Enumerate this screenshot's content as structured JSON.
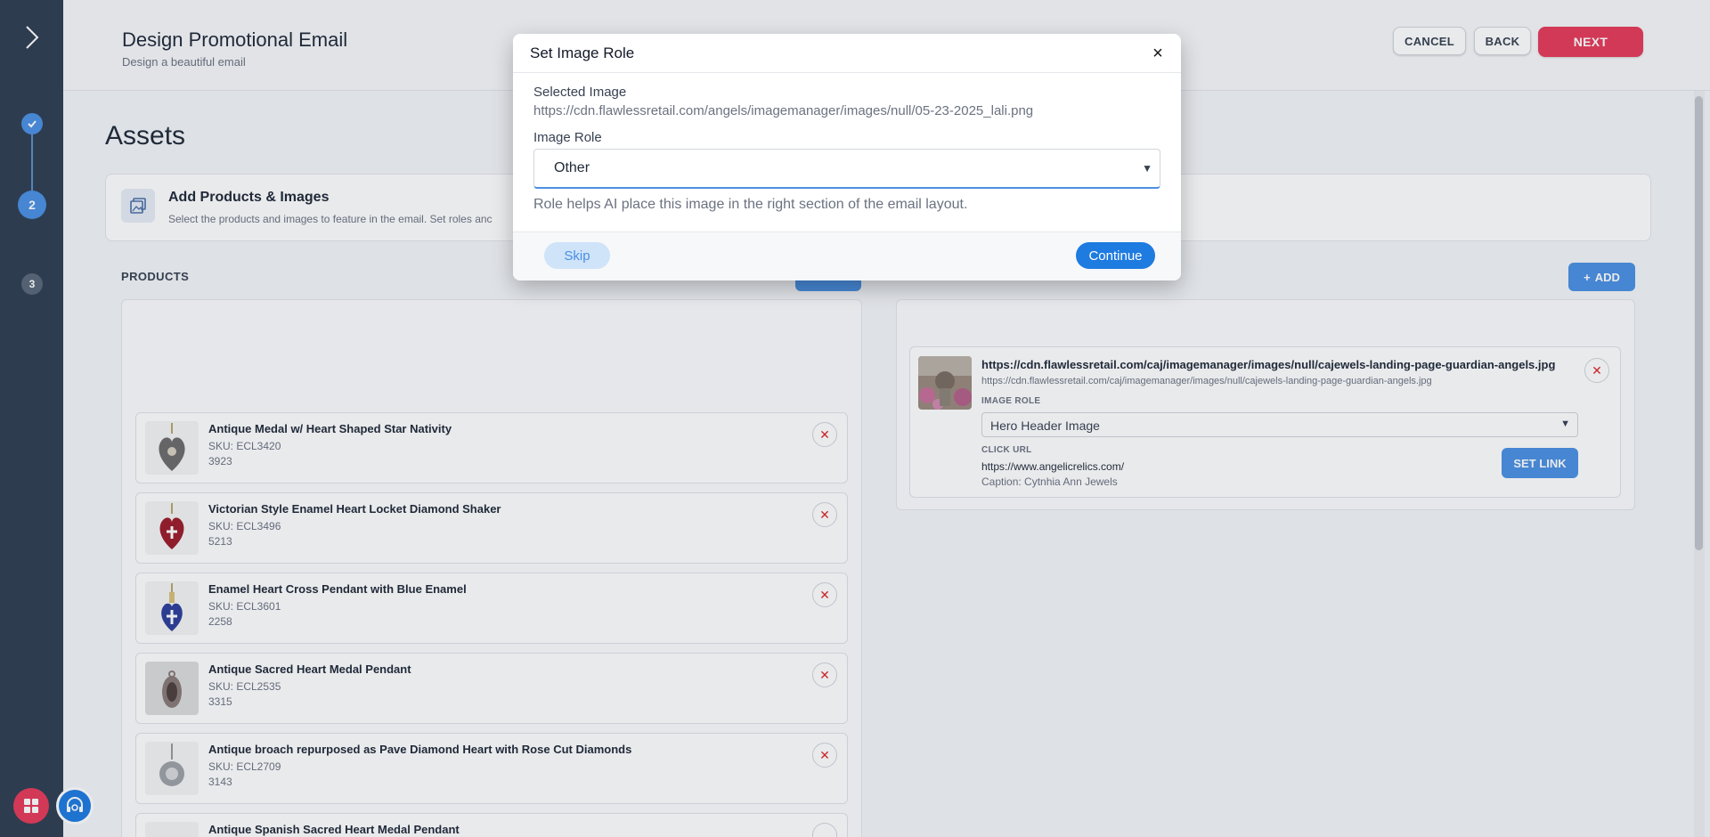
{
  "header": {
    "title": "Design Promotional Email",
    "subtitle": "Design a beautiful email",
    "cancel_label": "CANCEL",
    "back_label": "BACK",
    "next_label": "NEXT"
  },
  "steps": [
    "",
    "2",
    "3"
  ],
  "assets": {
    "title": "Assets",
    "card_title": "Add Products & Images",
    "card_desc": "Select the products and images to feature in the email. Set roles anc"
  },
  "products": {
    "label": "PRODUCTS",
    "items": [
      {
        "name": "Antique Medal w/ Heart Shaped Star Nativity",
        "sku": "SKU: ECL3420",
        "num": "3923"
      },
      {
        "name": "Victorian Style Enamel Heart Locket Diamond Shaker",
        "sku": "SKU: ECL3496",
        "num": "5213"
      },
      {
        "name": "Enamel Heart Cross Pendant with Blue Enamel",
        "sku": "SKU: ECL3601",
        "num": "2258"
      },
      {
        "name": "Antique Sacred Heart Medal Pendant",
        "sku": "SKU: ECL2535",
        "num": "3315"
      },
      {
        "name": "Antique broach repurposed as Pave Diamond Heart with Rose Cut Diamonds",
        "sku": "SKU: ECL2709",
        "num": "3143"
      },
      {
        "name": "Antique Spanish Sacred Heart Medal Pendant",
        "sku": "",
        "num": ""
      }
    ]
  },
  "images": {
    "add_label": "ADD",
    "card": {
      "title": "https://cdn.flawlessretail.com/caj/imagemanager/images/null/cajewels-landing-page-guardian-angels.jpg",
      "url": "https://cdn.flawlessretail.com/caj/imagemanager/images/null/cajewels-landing-page-guardian-angels.jpg",
      "role_label": "IMAGE ROLE",
      "role_value": "Hero Header Image",
      "click_label": "CLICK URL",
      "click_url": "https://www.angelicrelics.com/",
      "caption": "Caption: Cytnhia Ann Jewels",
      "set_link_label": "SET LINK"
    }
  },
  "modal": {
    "title": "Set Image Role",
    "close": "×",
    "selected_label": "Selected Image",
    "selected_value": "https://cdn.flawlessretail.com/angels/imagemanager/images/null/05-23-2025_lali.png",
    "role_label": "Image Role",
    "role_value": "Other",
    "hint": "Role helps AI place this image in the right section of the email layout.",
    "skip_label": "Skip",
    "continue_label": "Continue"
  },
  "colors": {
    "accent": "#4a90e2",
    "brand_red": "#e63a58",
    "rail": "#2f3e52"
  },
  "icons": {
    "toggle": "chevron-right-icon",
    "step_done": "check-icon",
    "card": "gallery-icon",
    "remove": "close-icon",
    "add": "plus-icon",
    "grid_fab": "grid-icon",
    "support_fab": "headset-icon"
  }
}
